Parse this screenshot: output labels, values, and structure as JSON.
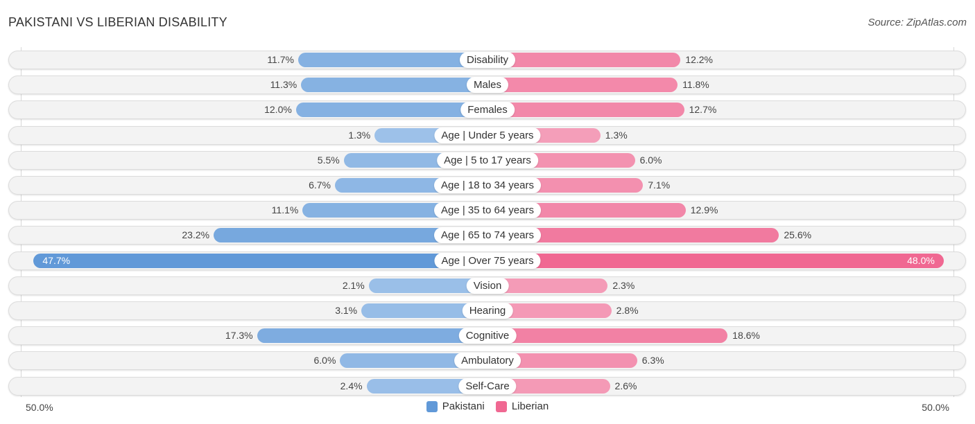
{
  "header": {
    "title": "PAKISTANI VS LIBERIAN DISABILITY",
    "source": "Source: ZipAtlas.com"
  },
  "colors": {
    "pakistani_strong": "#6199d8",
    "pakistani_light": "#a9c9ec",
    "liberian_strong": "#f06892",
    "liberian_light": "#f5a9c1"
  },
  "chart_data": {
    "type": "bar",
    "orientation": "horizontal-diverging",
    "title": "PAKISTANI VS LIBERIAN DISABILITY",
    "categories": [
      "Disability",
      "Males",
      "Females",
      "Age | Under 5 years",
      "Age | 5 to 17 years",
      "Age | 18 to 34 years",
      "Age | 35 to 64 years",
      "Age | 65 to 74 years",
      "Age | Over 75 years",
      "Vision",
      "Hearing",
      "Cognitive",
      "Ambulatory",
      "Self-Care"
    ],
    "series": [
      {
        "name": "Pakistani",
        "values": [
          11.7,
          11.3,
          12.0,
          1.3,
          5.5,
          6.7,
          11.1,
          23.2,
          47.7,
          2.1,
          3.1,
          17.3,
          6.0,
          2.4
        ],
        "labels": [
          "11.7%",
          "11.3%",
          "12.0%",
          "1.3%",
          "5.5%",
          "6.7%",
          "11.1%",
          "23.2%",
          "47.7%",
          "2.1%",
          "3.1%",
          "17.3%",
          "6.0%",
          "2.4%"
        ]
      },
      {
        "name": "Liberian",
        "values": [
          12.2,
          11.8,
          12.7,
          1.3,
          6.0,
          7.1,
          12.9,
          25.6,
          48.0,
          2.3,
          2.8,
          18.6,
          6.3,
          2.6
        ],
        "labels": [
          "12.2%",
          "11.8%",
          "12.7%",
          "1.3%",
          "6.0%",
          "7.1%",
          "12.9%",
          "25.6%",
          "48.0%",
          "2.3%",
          "2.8%",
          "18.6%",
          "6.3%",
          "2.6%"
        ]
      }
    ],
    "xlim": [
      -50,
      50
    ],
    "axis_labels": {
      "left": "50.0%",
      "right": "50.0%"
    },
    "legend": {
      "position": "bottom-center",
      "entries": [
        "Pakistani",
        "Liberian"
      ]
    },
    "unit": "%"
  }
}
